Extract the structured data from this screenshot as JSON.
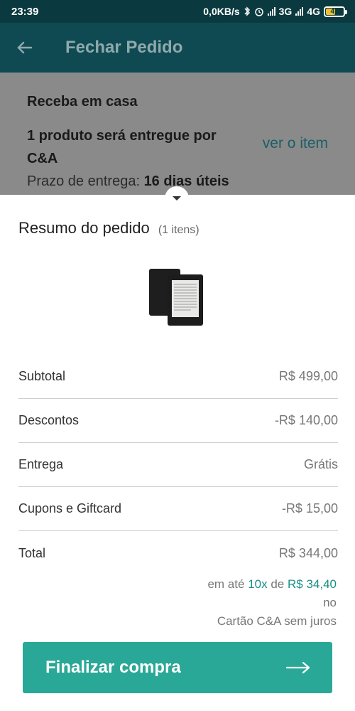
{
  "status_bar": {
    "time": "23:39",
    "network_speed": "0,0KB/s",
    "net1": "3G",
    "net2": "4G",
    "battery": "41",
    "icons": [
      "bluetooth-icon",
      "alarm-icon",
      "signal-icon",
      "signal-icon",
      "battery-icon"
    ]
  },
  "app_bar": {
    "title": "Fechar Pedido",
    "back_icon": "arrow-left-icon"
  },
  "delivery": {
    "heading": "Receba em casa",
    "line": "1 produto será entregue por C&A",
    "deadline_label": "Prazo de entrega:",
    "deadline_value": "16 dias úteis",
    "link": "ver o item"
  },
  "summary": {
    "title": "Resumo do pedido",
    "count": "(1 itens)",
    "rows": [
      {
        "label": "Subtotal",
        "value": "R$ 499,00"
      },
      {
        "label": "Descontos",
        "value": "-R$ 140,00"
      },
      {
        "label": "Entrega",
        "value": "Grátis"
      },
      {
        "label": "Cupons e Giftcard",
        "value": "-R$ 15,00"
      },
      {
        "label": "Total",
        "value": "R$ 344,00"
      }
    ],
    "installments": {
      "prefix": "em até",
      "count": "10x",
      "mid": "de",
      "amount": "R$ 34,40",
      "line2": "no",
      "line3": "Cartão C&A sem juros"
    }
  },
  "cta": {
    "label": "Finalizar compra",
    "icon": "arrow-right-icon",
    "color": "#2aa897"
  }
}
